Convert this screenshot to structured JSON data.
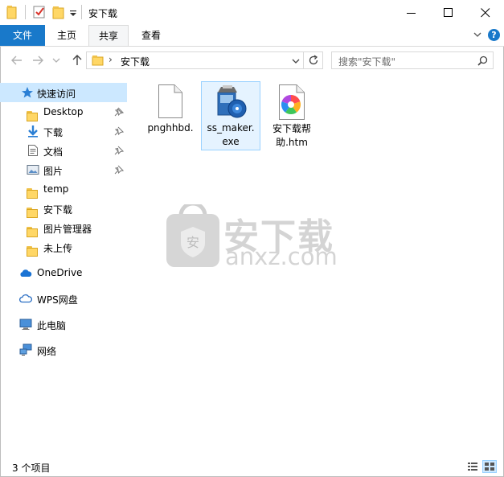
{
  "window": {
    "title": "安下载",
    "buttons": {
      "minimize": "—",
      "maximize": "☐",
      "close": "✕"
    }
  },
  "ribbon": {
    "tabs": [
      {
        "label": "文件",
        "active": false,
        "primary": true
      },
      {
        "label": "主页",
        "active": false
      },
      {
        "label": "共享",
        "active": true
      },
      {
        "label": "查看",
        "active": false
      }
    ],
    "help_glyph": "?",
    "collapse_glyph": "⌵"
  },
  "address": {
    "path": [
      "安下载"
    ],
    "separator": "›"
  },
  "search": {
    "placeholder": "搜索\"安下载\""
  },
  "navpane": {
    "quick_access": {
      "label": "快速访问",
      "icon": "star-icon"
    },
    "pinned": [
      {
        "label": "Desktop",
        "icon": "folder-icon",
        "pinned": true
      },
      {
        "label": "下载",
        "icon": "download-arrow-icon",
        "pinned": true
      },
      {
        "label": "文档",
        "icon": "document-icon",
        "pinned": true
      },
      {
        "label": "图片",
        "icon": "picture-icon",
        "pinned": true
      },
      {
        "label": "temp",
        "icon": "folder-icon",
        "pinned": false
      },
      {
        "label": "安下载",
        "icon": "folder-icon",
        "pinned": false
      },
      {
        "label": "图片管理器",
        "icon": "folder-icon",
        "pinned": false
      },
      {
        "label": "未上传",
        "icon": "folder-icon",
        "pinned": false
      }
    ],
    "locations": [
      {
        "label": "OneDrive",
        "icon": "cloud-icon"
      },
      {
        "label": "WPS网盘",
        "icon": "wps-cloud-icon"
      },
      {
        "label": "此电脑",
        "icon": "computer-icon"
      },
      {
        "label": "网络",
        "icon": "network-icon"
      }
    ]
  },
  "files": [
    {
      "name_line1": "pnghhbd.",
      "name_line2": "",
      "icon": "blank-file-icon",
      "selected": false
    },
    {
      "name_line1": "ss_maker.",
      "name_line2": "exe",
      "icon": "installer-exe-icon",
      "selected": true
    },
    {
      "name_line1": "安下载帮",
      "name_line2": "助.htm",
      "icon": "htm-file-icon",
      "selected": false
    }
  ],
  "watermark": {
    "text_cn": "安下载",
    "text_en": "anxz.com",
    "badge_char": "安"
  },
  "status": {
    "count_text": "3 个项目",
    "view_modes": [
      "details-view-icon",
      "large-icons-view-icon"
    ]
  },
  "colors": {
    "accent": "#1979ca",
    "selection": "#cce8ff",
    "folder": "#ffd766",
    "help": "#1979ca"
  }
}
